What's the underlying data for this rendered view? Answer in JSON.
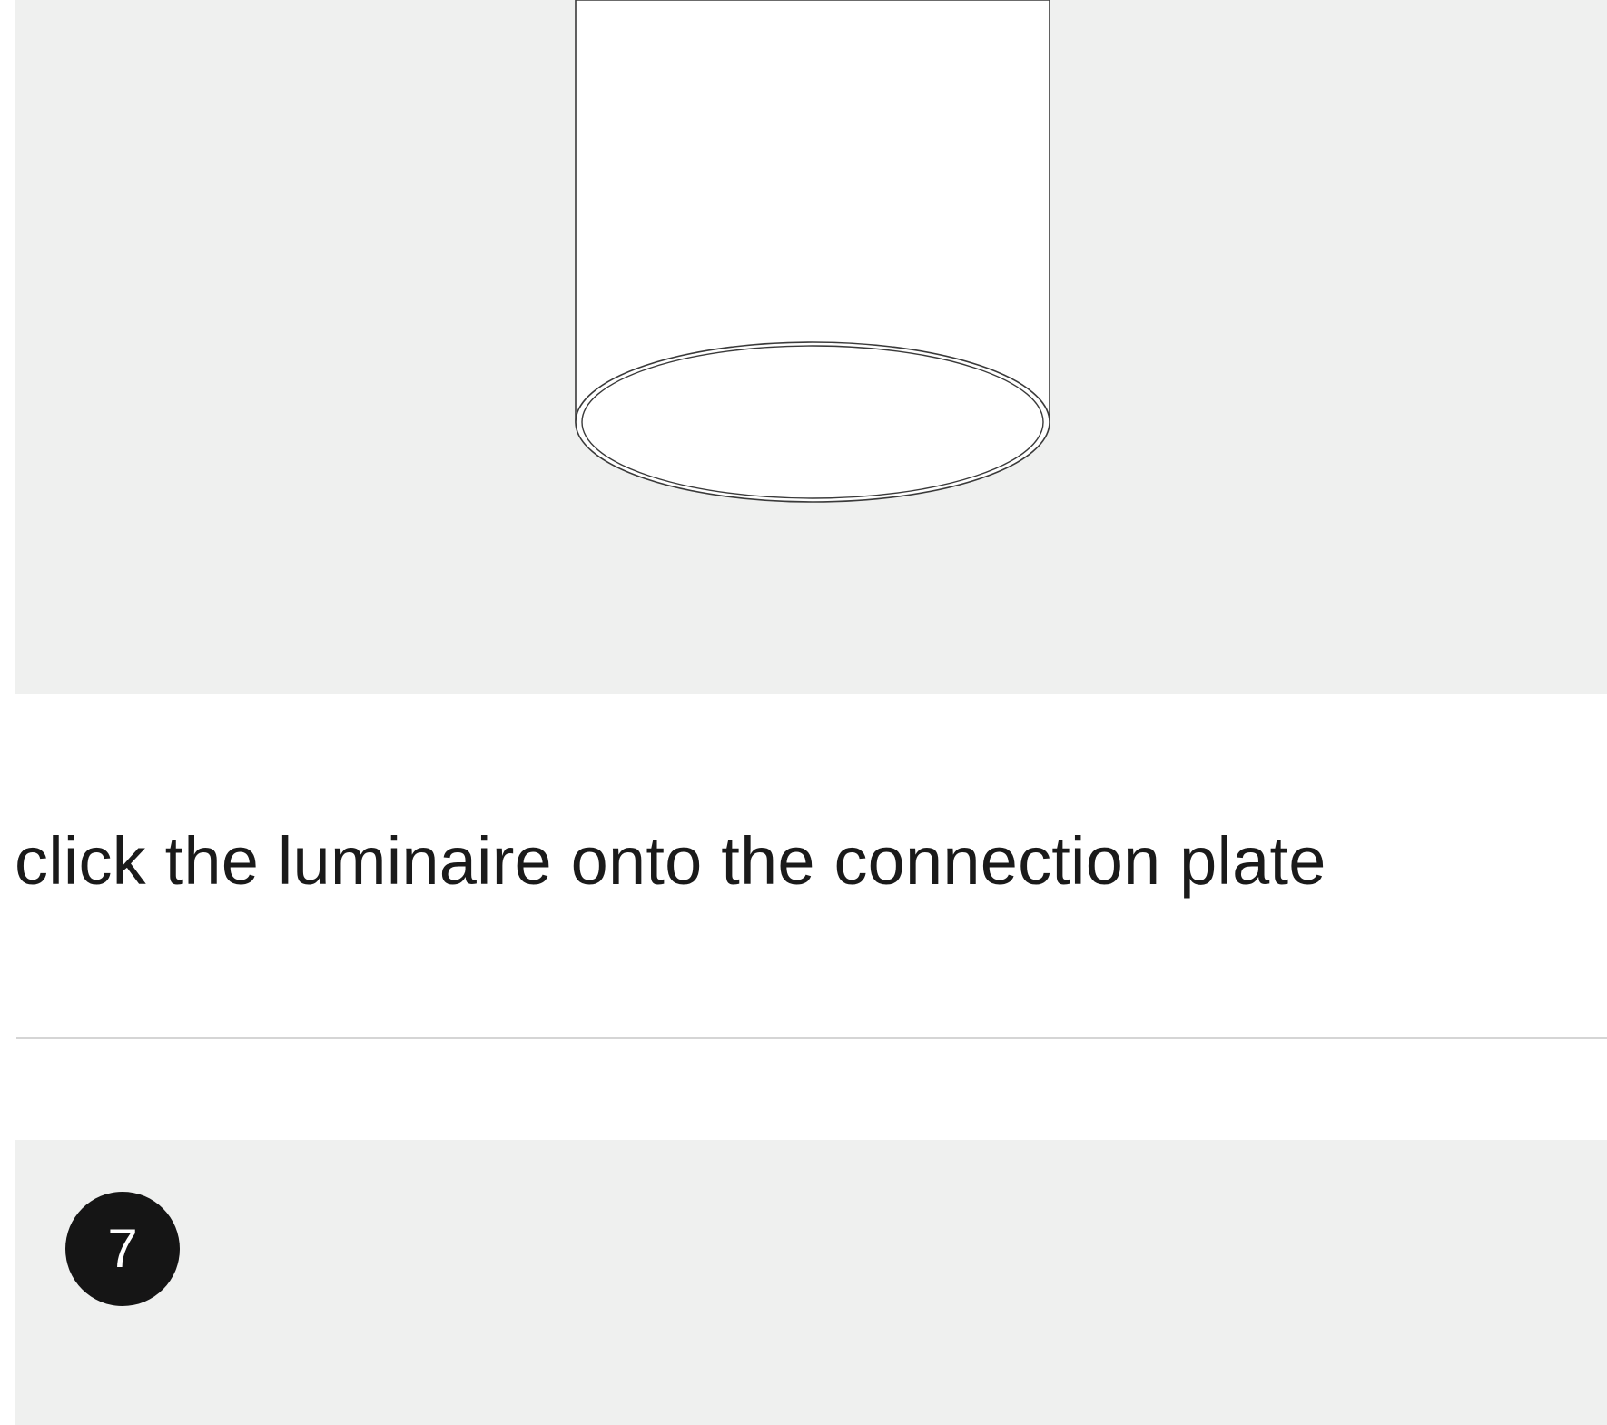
{
  "illustration": {
    "icon": "luminaire-cylinder-icon",
    "fill_color": "#ffffff",
    "stroke_color": "#3a3a3a"
  },
  "instruction": {
    "text": "click the luminaire onto the connection plate"
  },
  "next_step": {
    "number": "7",
    "badge_color": "#151515"
  },
  "colors": {
    "panel_background": "#eff0ef",
    "text": "#1a1a1a",
    "divider": "#d5d5d5"
  }
}
